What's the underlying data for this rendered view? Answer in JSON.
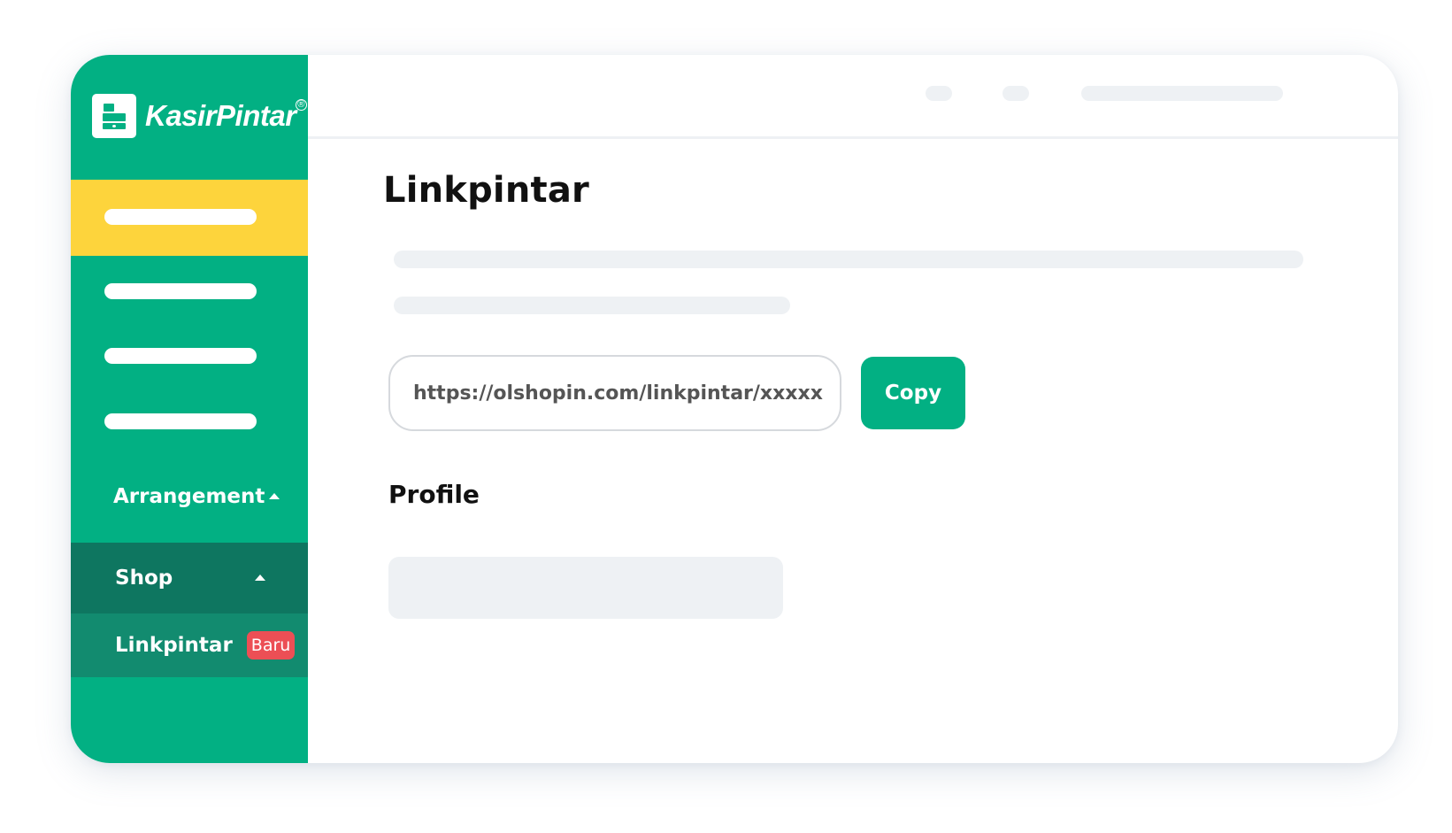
{
  "app": {
    "brand": "KasirPintar",
    "brand_reg": "®"
  },
  "sidebar": {
    "items": [
      {
        "label": "Arrangement",
        "icon": "caret-up-icon"
      },
      {
        "label": "Shop",
        "icon": "caret-up-icon"
      },
      {
        "label": "Linkpintar",
        "badge": "Baru"
      }
    ]
  },
  "main": {
    "title": "Linkpintar",
    "link_url": "https://olshopin.com/linkpintar/xxxxx",
    "copy_label": "Copy",
    "profile_title": "Profile"
  },
  "colors": {
    "brand_green": "#02b083",
    "active_yellow": "#fdd43c",
    "shop_dark_green": "#0e7660",
    "badge_red": "#ec4f55",
    "placeholder_gray": "#eef1f4"
  }
}
